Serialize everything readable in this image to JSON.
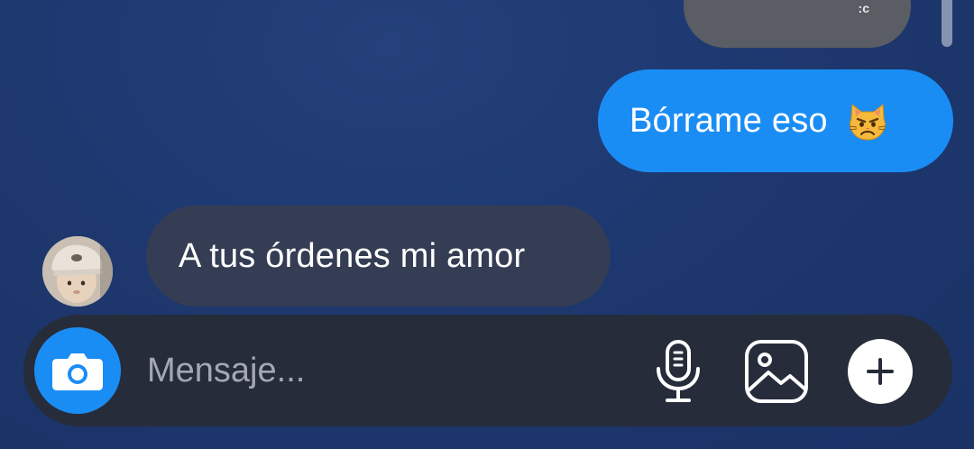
{
  "conversation": {
    "previous_message": {
      "text": ":c"
    },
    "outgoing_message": {
      "text": "Bórrame eso",
      "emoji": "pouting-cat-emoji"
    },
    "incoming_message": {
      "text": "A tus órdenes mi amor",
      "sender_avatar": "avatar"
    }
  },
  "composer": {
    "placeholder": "Mensaje...",
    "camera_icon": "camera-icon",
    "mic_icon": "microphone-icon",
    "gallery_icon": "image-gallery-icon",
    "plus_icon": "plus-icon"
  },
  "colors": {
    "background": "#1f3a72",
    "outgoing_bubble": "#1a8df5",
    "incoming_bubble": "#343d53",
    "previous_bubble": "#5a5d63",
    "composer_bg": "#262c3a",
    "accent": "#1a8df5"
  }
}
